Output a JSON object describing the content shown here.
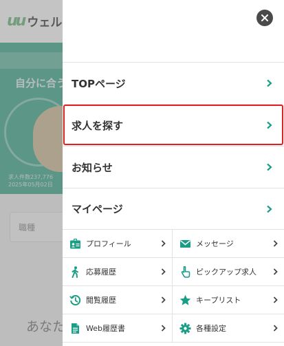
{
  "background": {
    "logo_mark": "uu",
    "logo_text": "ウェルミ",
    "hero_title": "自分に合う",
    "job_count_line1": "求人件数237,776",
    "job_count_line2": "2025年05月02日",
    "search_label": "職種",
    "bottom_text": "あなた"
  },
  "drawer": {
    "close_label": "閉じる",
    "menu": [
      {
        "label": "TOPページ"
      },
      {
        "label": "求人を探す"
      },
      {
        "label": "お知らせ"
      },
      {
        "label": "マイページ"
      }
    ],
    "grid": [
      {
        "label": "プロフィール",
        "icon": "id-card-icon"
      },
      {
        "label": "メッセージ",
        "icon": "envelope-icon"
      },
      {
        "label": "応募履歴",
        "icon": "person-walking-icon"
      },
      {
        "label": "ピックアップ求人",
        "icon": "pointer-hand-icon"
      },
      {
        "label": "閲覧履歴",
        "icon": "history-icon"
      },
      {
        "label": "キープリスト",
        "icon": "star-icon"
      },
      {
        "label": "Web履歴書",
        "icon": "document-icon"
      },
      {
        "label": "各種設定",
        "icon": "gear-icon"
      }
    ]
  },
  "colors": {
    "accent": "#1a9e86",
    "highlight": "#e02020",
    "close_bg": "#4a4a4a"
  }
}
